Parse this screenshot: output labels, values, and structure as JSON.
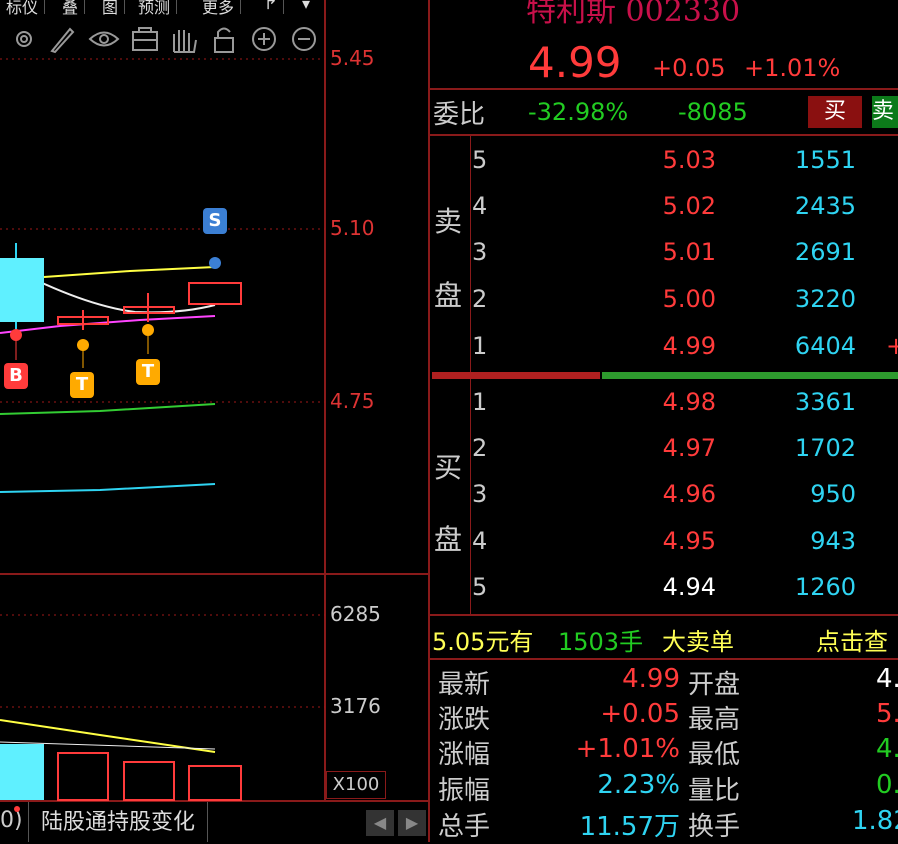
{
  "toolbar": {
    "labels": [
      "标仪",
      "叠",
      "图",
      "预测",
      "更多",
      "↱",
      "▾"
    ],
    "tools": [
      "gear-icon",
      "brush-icon",
      "eye-icon",
      "bag-icon",
      "hand-icon",
      "lock-icon",
      "zoom-in-icon",
      "zoom-out-icon"
    ]
  },
  "main_chart": {
    "price_ticks": [
      "5.45",
      "5.10",
      "4.75"
    ],
    "vol_ticks": [
      "6285",
      "3176"
    ],
    "scale_label": "X100",
    "badges": {
      "s": "S",
      "b": "B",
      "t": "T"
    }
  },
  "bottom_tabs": {
    "left_fragment": "0)",
    "tab1": "陆股通持股变化",
    "prev": "◀",
    "next": "▶"
  },
  "quote": {
    "name": "特利斯 002330",
    "price": "4.99",
    "change": "+0.05",
    "change_pct": "+1.01%"
  },
  "weibi": {
    "label": "委比",
    "pct": "-32.98%",
    "diff": "-8085",
    "buy": "买",
    "sell": "卖"
  },
  "sell_side": {
    "label_top": "卖",
    "label_bottom": "盘",
    "rows": [
      {
        "level": "5",
        "price": "5.03",
        "volume": "1551"
      },
      {
        "level": "4",
        "price": "5.02",
        "volume": "2435"
      },
      {
        "level": "3",
        "price": "5.01",
        "volume": "2691"
      },
      {
        "level": "2",
        "price": "5.00",
        "volume": "3220"
      },
      {
        "level": "1",
        "price": "4.99",
        "volume": "6404"
      }
    ],
    "row1_suffix": "+"
  },
  "buy_side": {
    "label_top": "买",
    "label_bottom": "盘",
    "rows": [
      {
        "level": "1",
        "price": "4.98",
        "volume": "3361"
      },
      {
        "level": "2",
        "price": "4.97",
        "volume": "1702"
      },
      {
        "level": "3",
        "price": "4.96",
        "volume": "950"
      },
      {
        "level": "4",
        "price": "4.95",
        "volume": "943"
      },
      {
        "level": "5",
        "price": "4.94",
        "volume": "1260"
      }
    ]
  },
  "alert": {
    "price": "5.05元有",
    "lots": "1503手",
    "type": "大卖单",
    "link": "点击查"
  },
  "stats": {
    "latest_label": "最新",
    "latest": "4.99",
    "open_label": "开盘",
    "open": "4.",
    "change_label": "涨跌",
    "change": "+0.05",
    "high_label": "最高",
    "high": "5.",
    "pct_label": "涨幅",
    "pct": "+1.01%",
    "low_label": "最低",
    "low": "4.",
    "amp_label": "振幅",
    "amp": "2.23%",
    "volratio_label": "量比",
    "volratio": "0.",
    "total_label": "总手",
    "total": "11.57万",
    "turnover_label": "换手",
    "turnover": "1.82"
  },
  "colors": {
    "up": "#ff3b3b",
    "down": "#22cc22",
    "cyan": "#2fd4f2",
    "yellow": "#ffff55",
    "grid_red": "#a01818"
  }
}
